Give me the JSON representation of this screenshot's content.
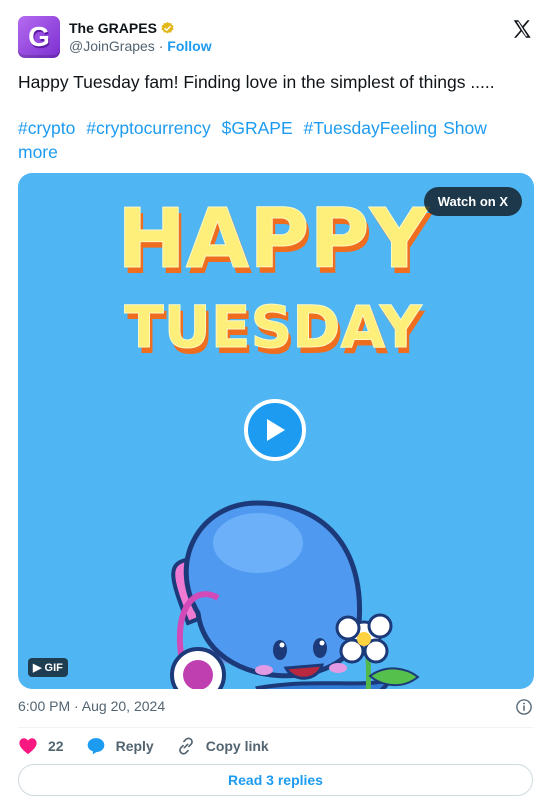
{
  "account": {
    "name": "The GRAPES",
    "handle": "@JoinGrapes",
    "separator": " · ",
    "follow_label": "Follow",
    "avatar_letter": "G"
  },
  "tweet": {
    "text": "Happy Tuesday fam! Finding love in the simplest of things .....",
    "hashtags": [
      "#crypto",
      "#cryptocurrency",
      "$GRAPE",
      "#TuesdayFeeling"
    ],
    "show_more": "Show more"
  },
  "media": {
    "watch_label": "Watch on X",
    "gif_label": "GIF",
    "headline_line1": "HAPPY",
    "headline_line2": "TUESDAY"
  },
  "meta": {
    "timestamp": "6:00 PM · Aug 20, 2024"
  },
  "actions": {
    "likes": "22",
    "reply_label": "Reply",
    "copy_label": "Copy link",
    "read_replies": "Read 3 replies"
  },
  "colors": {
    "accent": "#1d9bf0",
    "media_bg": "#4fb6f3",
    "like": "#f91880"
  }
}
